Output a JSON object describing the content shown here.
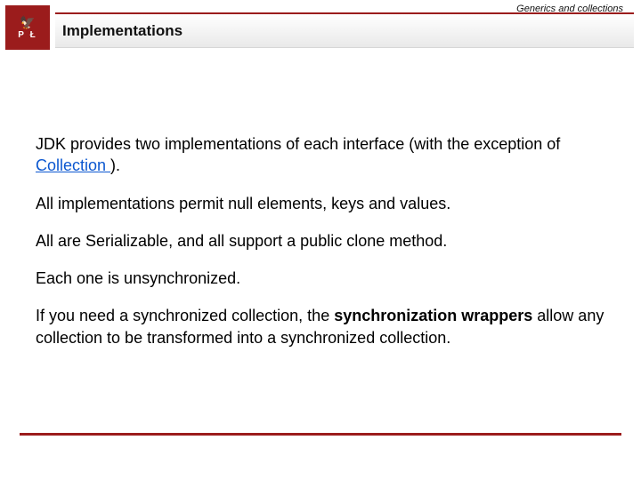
{
  "header": {
    "topic": "Generics and collections",
    "title": "Implementations",
    "logo": {
      "letters": "P   Ł"
    }
  },
  "body": {
    "p1_pre": "JDK  provides two implementations of each interface (with the exception of ",
    "p1_link": "Collection ",
    "p1_post": ").",
    "p2": "All implementations permit null elements, keys and values.",
    "p3": "All are Serializable, and all support a public clone method.",
    "p4": "Each one is unsynchronized.",
    "p5_pre": "If you need a synchronized collection, the ",
    "p5_bold": "synchronization wrappers",
    "p5_post": " allow any collection to be transformed into a synchronized collection."
  }
}
